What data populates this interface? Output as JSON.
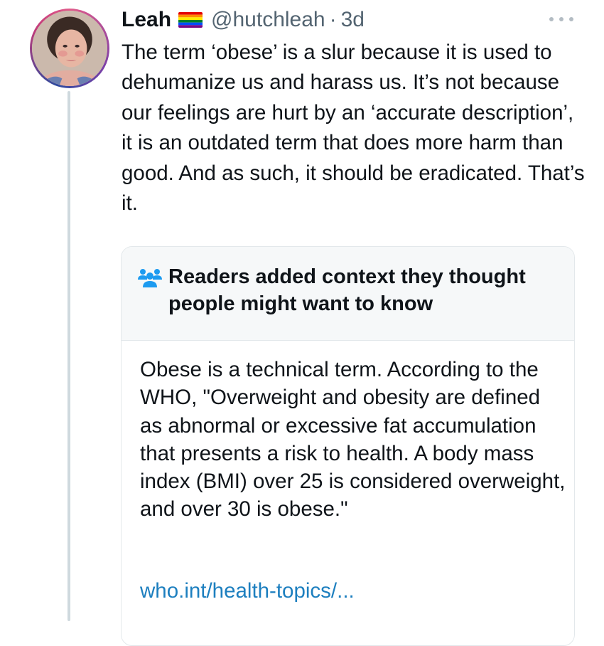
{
  "tweet": {
    "display_name": "Leah",
    "flag_icon": "rainbow-pride-flag-icon",
    "handle": "@hutchleah",
    "separator": "·",
    "time": "3d",
    "text": "The term ‘obese’ is a slur because it is used to dehumanize us and harass us. It’s not because our feelings are hurt by an ‘accurate description’, it is an outdated term that does more harm than good. And as such, it should be eradicated. That’s it."
  },
  "community_note": {
    "icon": "people-group-icon",
    "title": "Readers added context they thought people might want to know",
    "body": "Obese is a technical term. According to the WHO, \"Overweight and obesity are defined as abnormal or excessive fat accumulation that presents a risk to health. A body mass index (BMI) over 25 is considered overweight, and over 30 is obese.\"",
    "link": "who.int/health-topics/..."
  },
  "colors": {
    "text": "#0f1419",
    "secondary_text": "#536471",
    "link": "#1d7fbf",
    "note_header_bg": "#f6f8f9",
    "border": "#e3e8eb",
    "thread_line": "#cfd9de"
  }
}
